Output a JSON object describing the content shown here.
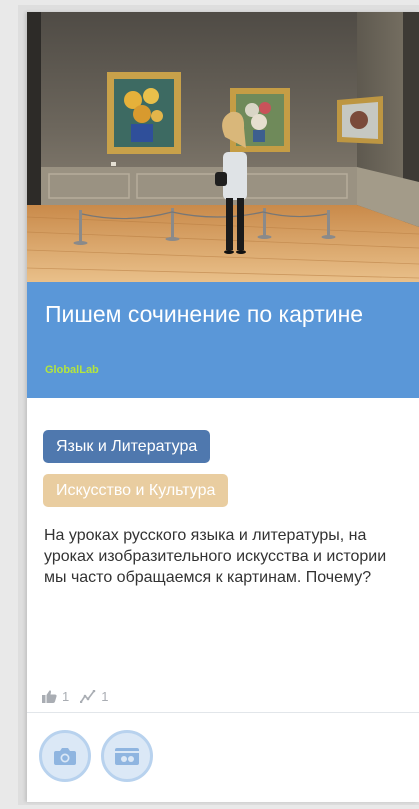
{
  "card": {
    "title": "Пишем сочинение по картине",
    "organization": "GlobalLab",
    "image_alt_icon": "museum-gallery-image",
    "tags": [
      {
        "label": "Язык и Литература",
        "color": "#4f78ae"
      },
      {
        "label": "Искусство и Культура",
        "color": "#e9cda0"
      }
    ],
    "description": "На уроках русского языка и литературы, на уроках изобразительного искусства и истории мы часто обращаемся к картинам. Почему?",
    "stats": {
      "likes": "1",
      "likes_icon": "thumbs-up-icon",
      "activity": "1",
      "activity_icon": "activity-chart-icon"
    },
    "footer_buttons": [
      {
        "icon": "camera-icon"
      },
      {
        "icon": "video-icon"
      }
    ]
  },
  "colors": {
    "title_band": "#5a97d8",
    "organization_text": "#b4e53e",
    "stat_text": "#a9adb3",
    "button_fill": "#dbe8f6",
    "button_border": "#b8d2ee",
    "icon_color": "#8fb5e0"
  }
}
